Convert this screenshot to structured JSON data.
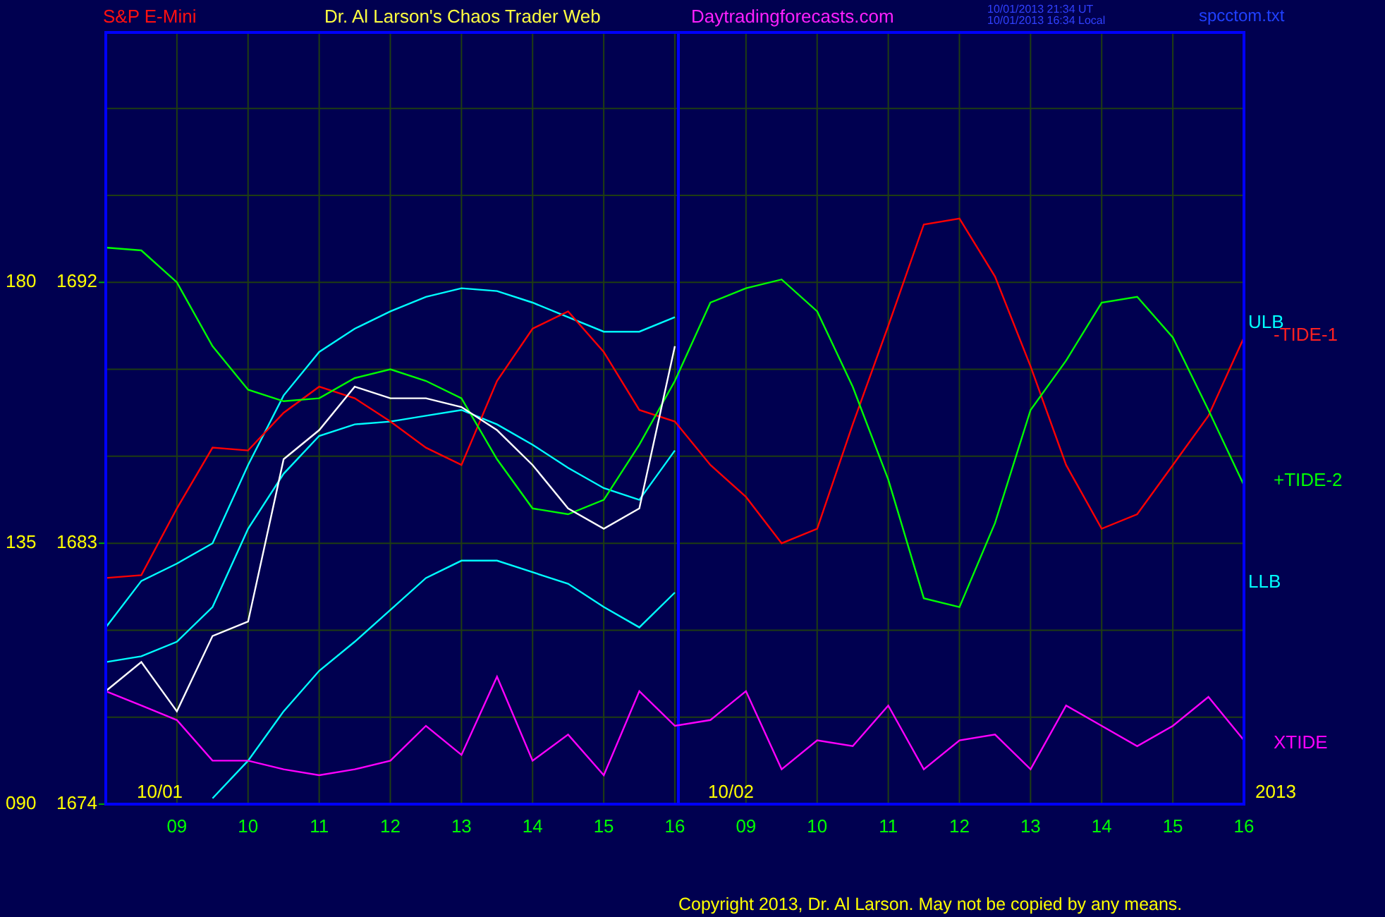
{
  "header": {
    "instrument": "S&P E-Mini",
    "title": "Dr. Al Larson's Chaos Trader Web",
    "site": "Daytradingforecasts.com",
    "timestamps": [
      "10/01/2013 21:34 UT",
      "10/01/2013 16:34 Local"
    ],
    "file": "spcctom.txt"
  },
  "chart_data": {
    "type": "line",
    "grid": true,
    "ylim": [
      1674,
      1700.67
    ],
    "categories": [
      null,
      null,
      "09",
      null,
      "10",
      null,
      "11",
      null,
      "12",
      null,
      "13",
      null,
      "14",
      null,
      "15",
      null,
      "16",
      null,
      "09",
      null,
      "10",
      null,
      "11",
      null,
      "12",
      null,
      "13",
      null,
      "14",
      null,
      "15",
      null,
      "16"
    ],
    "yticks": [
      1692,
      1683,
      1674
    ],
    "series": [
      {
        "color": "#00ffff",
        "values": [
          1680.1,
          1681.7,
          1682.3,
          1683.0,
          1685.7,
          1688.1,
          1689.6,
          1690.4,
          1691.0,
          1691.5,
          1691.8,
          1691.7,
          1691.3,
          1690.8,
          1690.3,
          1690.3,
          1690.8,
          null,
          null,
          null,
          null,
          null,
          null,
          null,
          null,
          null,
          null,
          null,
          null,
          null,
          null,
          null,
          null
        ]
      },
      {
        "color": "#00ffff",
        "values": [
          1678.9,
          1679.1,
          1679.6,
          1680.8,
          1683.5,
          1685.4,
          1686.7,
          1687.1,
          1687.2,
          1687.4,
          1687.6,
          1687.1,
          1686.4,
          1685.6,
          1684.9,
          1684.5,
          1686.2,
          null,
          null,
          null,
          null,
          null,
          null,
          null,
          null,
          null,
          null,
          null,
          null,
          null,
          null,
          null,
          null
        ]
      },
      {
        "color": "#00ffff",
        "values": [
          null,
          null,
          null,
          1674.2,
          1675.5,
          1677.2,
          1678.6,
          1679.6,
          1680.7,
          1681.8,
          1682.4,
          1682.4,
          1682.0,
          1681.6,
          1680.8,
          1680.1,
          1681.3,
          null,
          null,
          null,
          null,
          null,
          null,
          null,
          null,
          null,
          null,
          null,
          null,
          null,
          null,
          null,
          null
        ]
      },
      {
        "color": "#ff0000",
        "values": [
          1681.8,
          1681.9,
          1684.2,
          1686.3,
          1686.2,
          1687.5,
          1688.4,
          1688.0,
          1687.2,
          1686.3,
          1685.7,
          1688.6,
          1690.4,
          1691.0,
          1689.6,
          1687.6,
          1687.2,
          1685.7,
          1684.6,
          1683.0,
          1683.5,
          1687.1,
          1690.5,
          1694.0,
          1694.2,
          1692.2,
          1689.1,
          1685.7,
          1683.5,
          1684.0,
          1685.7,
          1687.4,
          1690.1
        ]
      },
      {
        "color": "#00ff00",
        "values": [
          1693.2,
          1693.1,
          1692.0,
          1689.8,
          1688.3,
          1687.9,
          1688.0,
          1688.7,
          1689.0,
          1688.6,
          1688.0,
          1685.9,
          1684.2,
          1684.0,
          1684.5,
          1686.4,
          1688.6,
          1691.3,
          1691.8,
          1692.1,
          1691.0,
          1688.4,
          1685.2,
          1681.1,
          1680.8,
          1683.7,
          1687.6,
          1689.3,
          1691.3,
          1691.5,
          1690.1,
          1687.6,
          1685.0
        ]
      },
      {
        "color": "#ff00ff",
        "values": [
          1677.9,
          1677.4,
          1676.9,
          1675.5,
          1675.5,
          1675.2,
          1675.0,
          1675.2,
          1675.5,
          1676.7,
          1675.7,
          1678.4,
          1675.5,
          1676.4,
          1675.0,
          1677.9,
          1676.7,
          1676.9,
          1677.9,
          1675.2,
          1676.2,
          1676.0,
          1677.4,
          1675.2,
          1676.2,
          1676.4,
          1675.2,
          1677.4,
          1676.7,
          1676.0,
          1676.7,
          1677.7,
          1676.2
        ]
      },
      {
        "color": "#ffffff",
        "values": [
          1677.9,
          1678.9,
          1677.2,
          1679.8,
          1680.3,
          1685.9,
          1686.9,
          1688.4,
          1688.0,
          1688.0,
          1687.7,
          1686.9,
          1685.7,
          1684.2,
          1683.5,
          1684.2,
          1689.8,
          null,
          null,
          null,
          null,
          null,
          null,
          null,
          null,
          null,
          null,
          null,
          null,
          null,
          null,
          null,
          null
        ]
      }
    ]
  },
  "left_scale": [
    "180",
    "135",
    "090"
  ],
  "line_labels": [
    {
      "text": "ULB",
      "color": "#00ffff"
    },
    {
      "text": "-TIDE-1",
      "color": "#ff2020"
    },
    {
      "text": "+TIDE-2",
      "color": "#00ff00"
    },
    {
      "text": "LLB",
      "color": "#00ffff"
    },
    {
      "text": "XTIDE",
      "color": "#ff00ff"
    }
  ],
  "date_labels": [
    "10/01",
    "10/02",
    "2013"
  ],
  "copyright": "Copyright 2013, Dr. Al Larson. May not be copied by any means."
}
